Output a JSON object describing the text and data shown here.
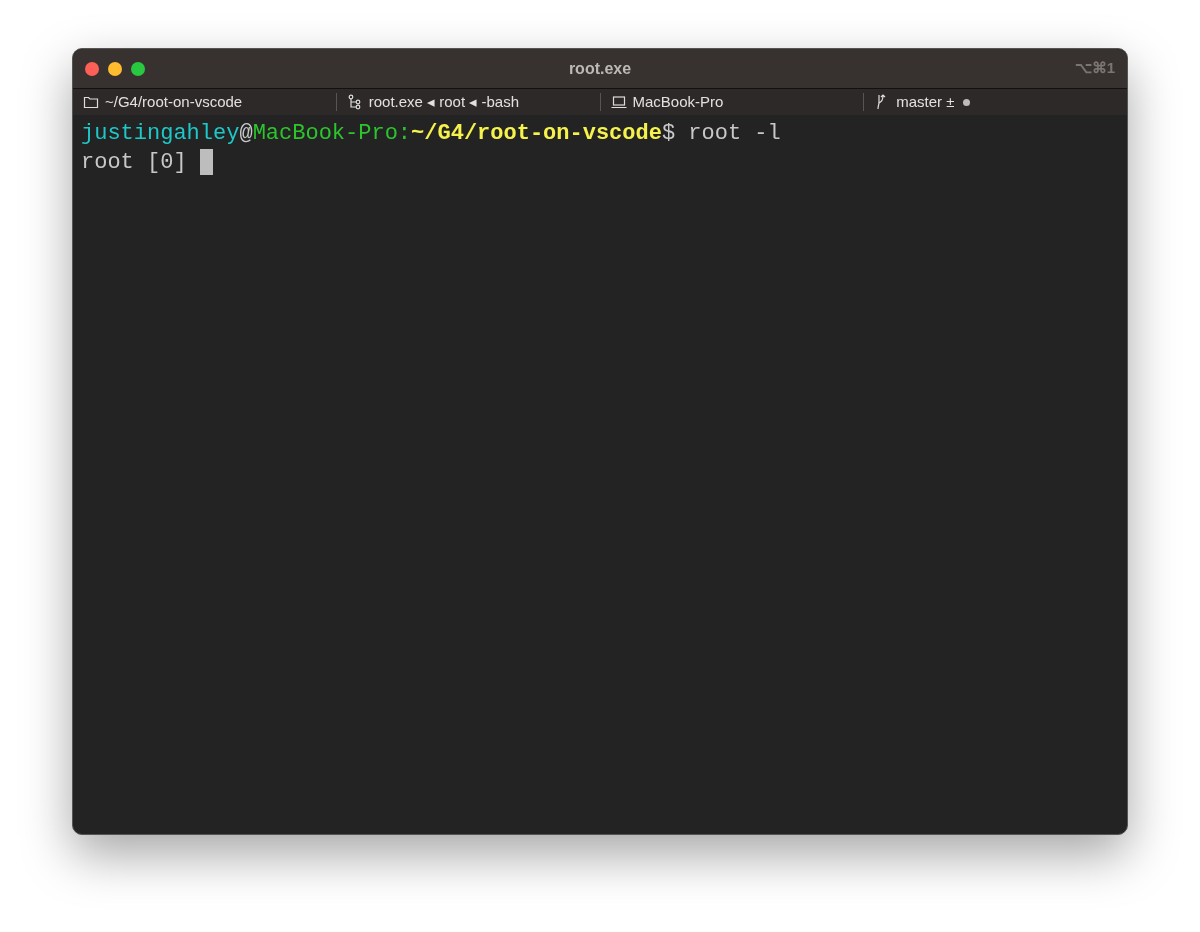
{
  "window": {
    "title": "root.exe",
    "shortcut": "⌥⌘1"
  },
  "status_bar": [
    {
      "kind": "folder",
      "text": "~/G4/root-on-vscode"
    },
    {
      "kind": "process",
      "text": "root.exe ◂ root ◂ -bash"
    },
    {
      "kind": "host",
      "text": "MacBook-Pro"
    },
    {
      "kind": "git",
      "text": "master ±",
      "dirty": true
    }
  ],
  "terminal": {
    "lines": [
      {
        "segments": [
          {
            "text": "justingahley",
            "color": "#1ec8c8",
            "bold": false
          },
          {
            "text": "@",
            "color": "#c8c8c8",
            "bold": false
          },
          {
            "text": "MacBook-Pro:",
            "color": "#2cc52c",
            "bold": false
          },
          {
            "text": "~/G4/root-on-vscode",
            "color": "#f6f24c",
            "bold": true
          },
          {
            "text": "$ root -l",
            "color": "#c8c8c8",
            "bold": false
          }
        ],
        "cursor": false
      },
      {
        "segments": [
          {
            "text": "root [0]",
            "color": "#c8c8c8",
            "bold": false
          }
        ],
        "cursor": true
      }
    ]
  }
}
